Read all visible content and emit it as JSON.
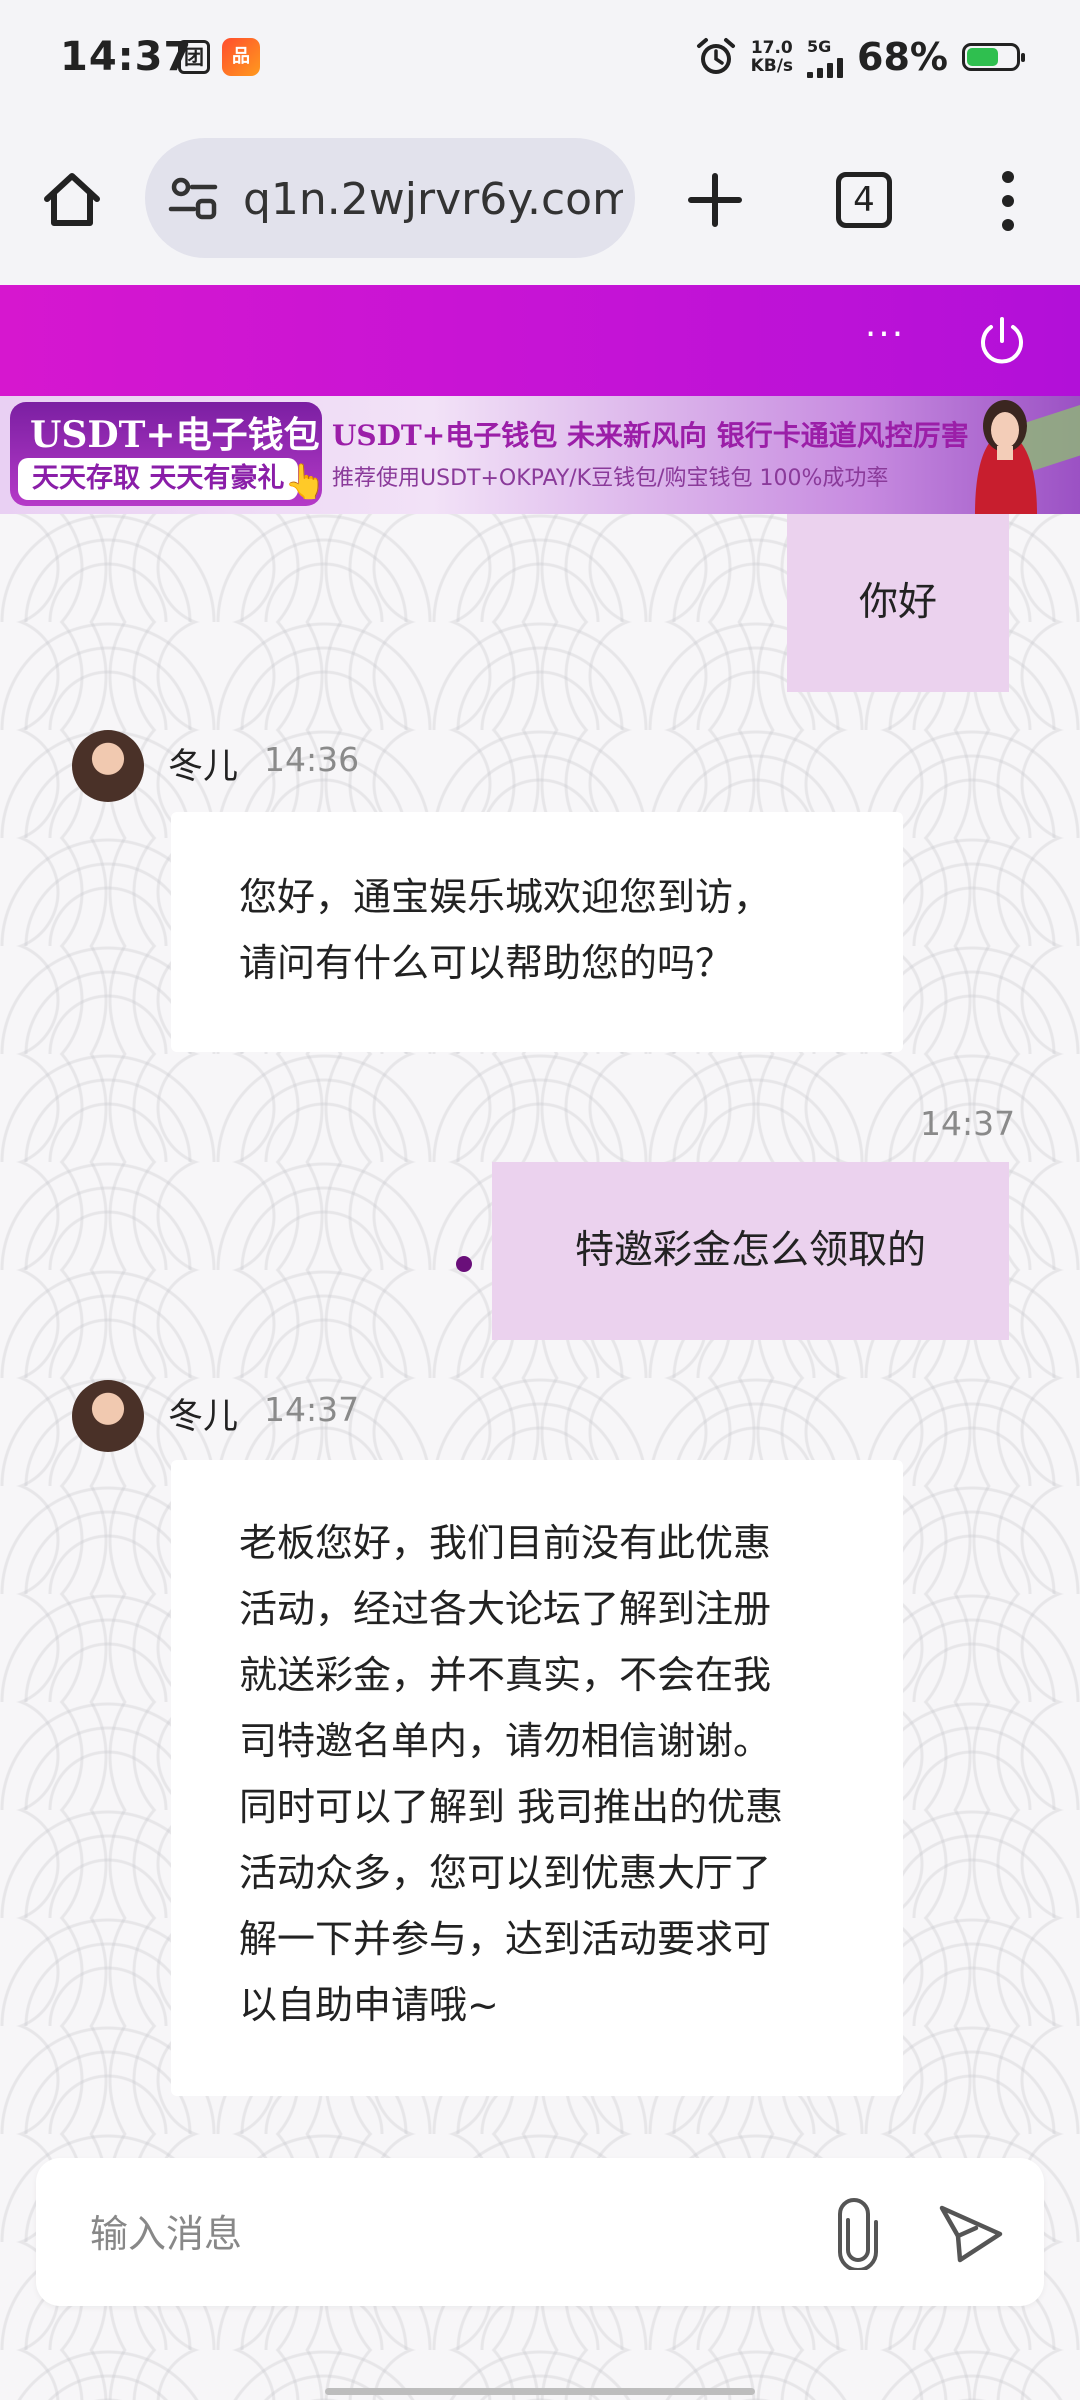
{
  "status_bar": {
    "time": "14:37",
    "notif_icon_1": "团",
    "app_badge_icon": "品",
    "net_speed_value": "17.0",
    "net_speed_unit": "KB/s",
    "network_type": "5G",
    "battery_percent": "68%",
    "battery_level": 0.68,
    "icons": [
      "alarm-icon",
      "signal-icon",
      "battery-icon"
    ]
  },
  "browser": {
    "url": "q1n.2wjrvr6y.com",
    "tab_count": "4",
    "icons": [
      "home-icon",
      "site-settings-icon",
      "plus-icon",
      "tabs-icon",
      "more-vert-icon"
    ]
  },
  "site_header": {
    "more_label": "···",
    "icons": [
      "more-horiz-icon",
      "power-icon"
    ],
    "accent_color": "#c313d6"
  },
  "banner": {
    "left_line1": "USDT+电子钱包",
    "left_line2": "天天存取 天天有豪礼",
    "mid_line1": "USDT+电子钱包  未来新风向  银行卡通道风控厉害",
    "mid_line2": "推荐使用USDT+OKPAY/K豆钱包/购宝钱包  100%成功率"
  },
  "chat": {
    "messages": [
      {
        "dir": "out",
        "text": "你好"
      },
      {
        "dir": "in",
        "sender": "冬儿",
        "time": "14:36",
        "text": [
          "您好，通宝娱乐城欢迎您到访，",
          "请问有什么可以帮助您的吗？"
        ]
      },
      {
        "dir": "out",
        "time": "14:37",
        "text": "特邀彩金怎么领取的"
      },
      {
        "dir": "in",
        "sender": "冬儿",
        "time": "14:37",
        "text": [
          "老板您好，我们目前没有此优惠",
          "活动，经过各大论坛了解到注册",
          "就送彩金，并不真实，不会在我",
          "司特邀名单内，请勿相信谢谢。",
          "同时可以了解到 我司推出的优惠",
          "活动众多，您可以到优惠大厅了",
          "解一下并参与，达到活动要求可",
          "以自助申请哦~"
        ]
      }
    ],
    "out_bubble_color": "#ebd2ee"
  },
  "composer": {
    "placeholder": "输入消息",
    "icons": [
      "paperclip-icon",
      "send-icon"
    ]
  }
}
